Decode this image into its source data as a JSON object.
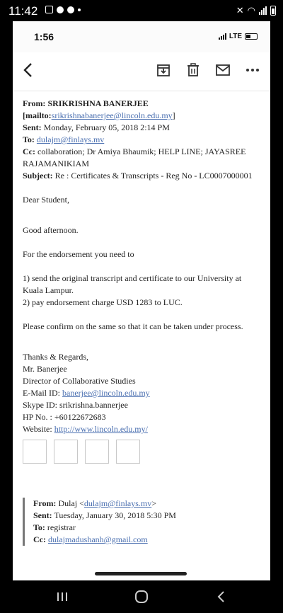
{
  "outer_status": {
    "time": "11:42"
  },
  "inner_status": {
    "time": "1:56",
    "network": "LTE"
  },
  "email": {
    "from_label": "From:",
    "from_value": "SRIKRISHNA BANERJEE [mailto:",
    "from_link": "srikrishnabanerjee@lincoln.edu.my",
    "from_close": "]",
    "sent_label": "Sent:",
    "sent_value": "Monday, February 05, 2018 2:14 PM",
    "to_label": "To:",
    "to_link": "dulajm@finlays.mv",
    "cc_label": "Cc:",
    "cc_value": "collaboration; Dr Amiya Bhaumik; HELP LINE; JAYASREE RAJAMANIKIAM",
    "subject_label": "Subject:",
    "subject_value": "Re : Certificates & Transcripts - Reg No - LC0007000001",
    "greeting": "Dear Student,",
    "salutation": "Good afternoon.",
    "intro": "For the endorsement you need to",
    "step1": "1) send the original transcript and certificate to our University at Kuala Lampur.",
    "step2": "2) pay endorsement charge USD 1283 to LUC.",
    "confirm": "Please confirm on the same so that it can be taken under process.",
    "sig_regards": "Thanks & Regards,",
    "sig_name": "Mr. Banerjee",
    "sig_title": "Director of Collaborative Studies",
    "sig_email_label": "E-Mail ID:",
    "sig_email_link": "banerjee@lincoln.edu.my",
    "sig_skype": "Skype ID: srikrishna.bannerjee",
    "sig_phone": "HP No. : +60122672683",
    "sig_website_label": "Website:",
    "sig_website_link": "http://www.lincoln.edu.my/"
  },
  "quoted": {
    "from_label": "From:",
    "from_name": "Dulaj <",
    "from_link": "dulajm@finlays.mv",
    "from_close": ">",
    "sent_label": "Sent:",
    "sent_value": "Tuesday, January 30, 2018 5:30 PM",
    "to_label": "To:",
    "to_value": "registrar",
    "cc_label": "Cc:",
    "cc_link": "dulajmadushanh@gmail.com"
  },
  "icons": [
    "back-arrow-icon",
    "archive-icon",
    "trash-icon",
    "mail-icon",
    "more-icon"
  ]
}
